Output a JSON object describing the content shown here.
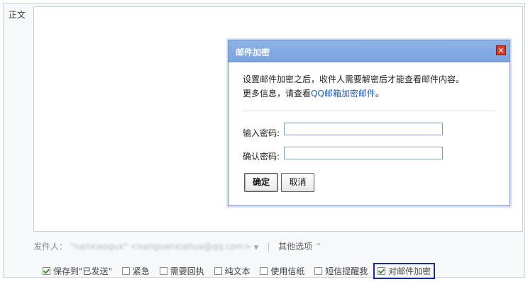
{
  "editor": {
    "body_label": "正文"
  },
  "dialog": {
    "title": "邮件加密",
    "close_glyph": "✕",
    "desc_line1": "设置邮件加密之后，收件人需要解密后才能查看邮件内容。",
    "desc_line2_prefix": "更多信息，请查看",
    "desc_link": "QQ邮箱加密邮件",
    "desc_line2_suffix": "。",
    "password_label": "输入密码:",
    "confirm_label": "确认密码:",
    "ok_label": "确定",
    "cancel_label": "取消"
  },
  "sender": {
    "label": "发件人：",
    "name": "\"nanxiaoqux\"",
    "address": "<nanguanxiahua@qq.com>",
    "dropdown_glyph": "▼",
    "separator": "|",
    "other_options": "其他选项",
    "other_options_glyph": "⌃"
  },
  "options": [
    {
      "label": "保存到\"已发送\"",
      "checked": true
    },
    {
      "label": "紧急",
      "checked": false
    },
    {
      "label": "需要回执",
      "checked": false
    },
    {
      "label": "纯文本",
      "checked": false
    },
    {
      "label": "使用信纸",
      "checked": false
    },
    {
      "label": "短信提醒我",
      "checked": false
    },
    {
      "label": "对邮件加密",
      "checked": true
    }
  ]
}
